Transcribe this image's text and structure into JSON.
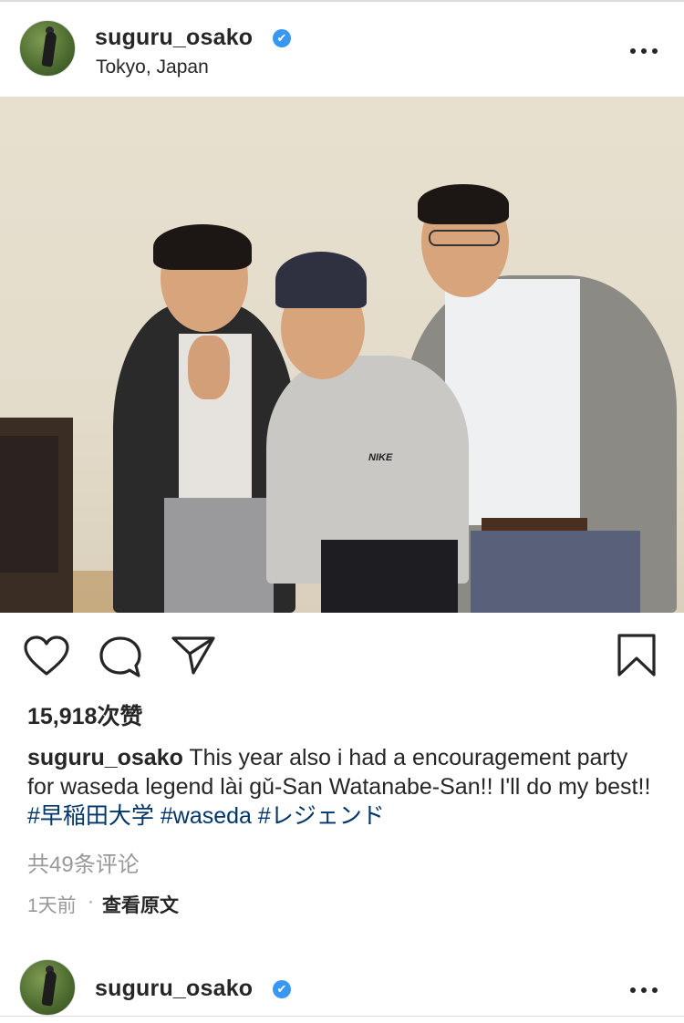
{
  "post": {
    "username": "suguru_osako",
    "verified_badge": "✔",
    "location": "Tokyo, Japan",
    "photo": {
      "shirt_logo": "NIKE"
    },
    "likes_text": "15,918次赞",
    "caption": {
      "username": "suguru_osako",
      "text": "This year also i had a encouragement party for waseda legend lài gǔ-San Watanabe-San!! I'll do my best!!",
      "hashtags": [
        "#早稲田大学",
        "#waseda",
        "#レジェンド"
      ]
    },
    "comments_text": "共49条评论",
    "timestamp": "1天前",
    "separator": "·",
    "see_original": "查看原文"
  },
  "next_post": {
    "username": "suguru_osako",
    "verified_badge": "✔"
  },
  "icons": {
    "like": "heart-icon",
    "comment": "comment-bubble-icon",
    "share": "paper-plane-icon",
    "save": "bookmark-icon",
    "more": "more-options-icon"
  },
  "colors": {
    "verified": "#3897f0",
    "hashtag": "#003569",
    "muted_text": "#999999",
    "text": "#262626"
  }
}
